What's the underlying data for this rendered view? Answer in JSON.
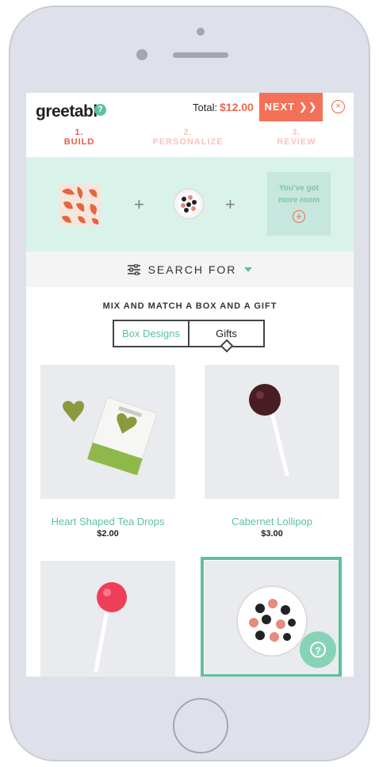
{
  "header": {
    "logo": "greetabl",
    "help_badge": "?",
    "total_label": "Total:",
    "total_value": "$12.00",
    "next_label": "NEXT ❯❯",
    "close_symbol": "×"
  },
  "steps": [
    {
      "number": "1.",
      "label": "BUILD",
      "active": true
    },
    {
      "number": "2.",
      "label": "PERSONALIZE",
      "active": false
    },
    {
      "number": "3.",
      "label": "REVIEW",
      "active": false
    }
  ],
  "builder": {
    "plus_symbol": "+",
    "room_text": "You've got more room",
    "room_plus": "+"
  },
  "search": {
    "label": "SEARCH FOR"
  },
  "catalog": {
    "heading": "MIX AND MATCH A BOX AND A GIFT",
    "tabs": [
      "Box Designs",
      "Gifts"
    ],
    "selected_tab": "Gifts"
  },
  "products": [
    {
      "name": "Heart Shaped Tea Drops",
      "price": "$2.00"
    },
    {
      "name": "Cabernet Lollipop",
      "price": "$3.00"
    },
    {
      "name": "",
      "price": ""
    },
    {
      "name": "",
      "price": ""
    }
  ],
  "colors": {
    "accent": "#f47057",
    "brand_green": "#5cc1a1",
    "builder_bg": "#daf3ea"
  },
  "icons": [
    "help-icon",
    "close-icon",
    "filter-icon",
    "caret-down-icon",
    "chat-help-icon"
  ]
}
